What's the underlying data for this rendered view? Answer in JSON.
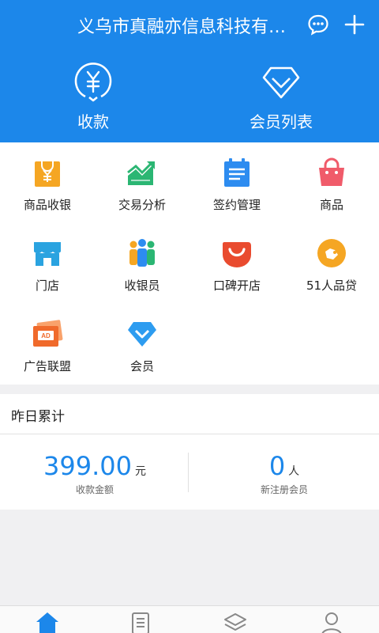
{
  "header": {
    "title": "义乌市真融亦信息科技有…",
    "actions": [
      {
        "label": "收款",
        "icon": "yuan-circle-icon"
      },
      {
        "label": "会员列表",
        "icon": "diamond-icon"
      }
    ],
    "icons": [
      "chat-icon",
      "plus-icon"
    ]
  },
  "grid": [
    {
      "label": "商品收银",
      "icon": "shopping-bag-yuan-icon",
      "color": "#f5a623"
    },
    {
      "label": "交易分析",
      "icon": "trend-chart-icon",
      "color": "#2bb673"
    },
    {
      "label": "签约管理",
      "icon": "calendar-doc-icon",
      "color": "#2d8cf0"
    },
    {
      "label": "商品",
      "icon": "basket-icon",
      "color": "#f05b6a"
    },
    {
      "label": "门店",
      "icon": "storefront-icon",
      "color": "#2aa3e0"
    },
    {
      "label": "收银员",
      "icon": "people-group-icon",
      "color": "#f5a623"
    },
    {
      "label": "口碑开店",
      "icon": "smile-icon",
      "color": "#e94b2f"
    },
    {
      "label": "51人品贷",
      "icon": "loan-coin-icon",
      "color": "#f5a623"
    },
    {
      "label": "广告联盟",
      "icon": "ad-card-icon",
      "color": "#f06a2b"
    },
    {
      "label": "会员",
      "icon": "member-diamond-icon",
      "color": "#2d9cf0"
    }
  ],
  "stats": {
    "title": "昨日累计",
    "revenue": {
      "value": "399.00",
      "unit": "元",
      "caption": "收款金额"
    },
    "new_members": {
      "value": "0",
      "unit": "人",
      "caption": "新注册会员"
    }
  },
  "tabbar": [
    "home-icon",
    "document-icon",
    "layers-icon",
    "user-icon"
  ],
  "colors": {
    "brand": "#1c87ea"
  }
}
